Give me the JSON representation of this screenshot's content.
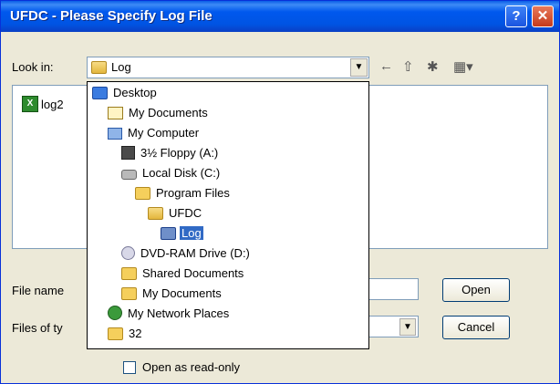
{
  "window": {
    "title": "UFDC - Please Specify Log File"
  },
  "titlebar": {
    "help_label": "?",
    "close_label": "✕"
  },
  "lookin": {
    "label": "Look in:",
    "value": "Log"
  },
  "toolbar": {
    "back_icon": "back-arrow-icon",
    "up_icon": "up-folder-icon",
    "newfolder_icon": "new-folder-icon",
    "views_icon": "views-menu-icon"
  },
  "files": [
    {
      "name": "log2",
      "icon": "excel-file-icon"
    }
  ],
  "filename": {
    "label": "File name",
    "value": ""
  },
  "filetype": {
    "label": "Files of ty",
    "value": ""
  },
  "buttons": {
    "open": "Open",
    "cancel": "Cancel"
  },
  "readonly": {
    "label": "Open as read-only"
  },
  "dropdown": {
    "items": [
      {
        "label": "Desktop",
        "icon": "desktop-icon"
      },
      {
        "label": "My Documents",
        "icon": "documents-icon"
      },
      {
        "label": "My Computer",
        "icon": "computer-icon"
      },
      {
        "label": "3½ Floppy (A:)",
        "icon": "floppy-icon"
      },
      {
        "label": "Local Disk (C:)",
        "icon": "disk-icon"
      },
      {
        "label": "Program Files",
        "icon": "folder-icon"
      },
      {
        "label": "UFDC",
        "icon": "folder-icon"
      },
      {
        "label": "Log",
        "icon": "folder-icon",
        "selected": true
      },
      {
        "label": "DVD-RAM Drive (D:)",
        "icon": "dvd-icon"
      },
      {
        "label": "Shared Documents",
        "icon": "folder-icon"
      },
      {
        "label": "My Documents",
        "icon": "folder-icon"
      },
      {
        "label": "My Network Places",
        "icon": "network-icon"
      },
      {
        "label": "32",
        "icon": "folder-icon"
      }
    ]
  },
  "colors": {
    "titlebar": "#0054e3",
    "selection": "#316ac5",
    "dialog_bg": "#ece9d8"
  }
}
